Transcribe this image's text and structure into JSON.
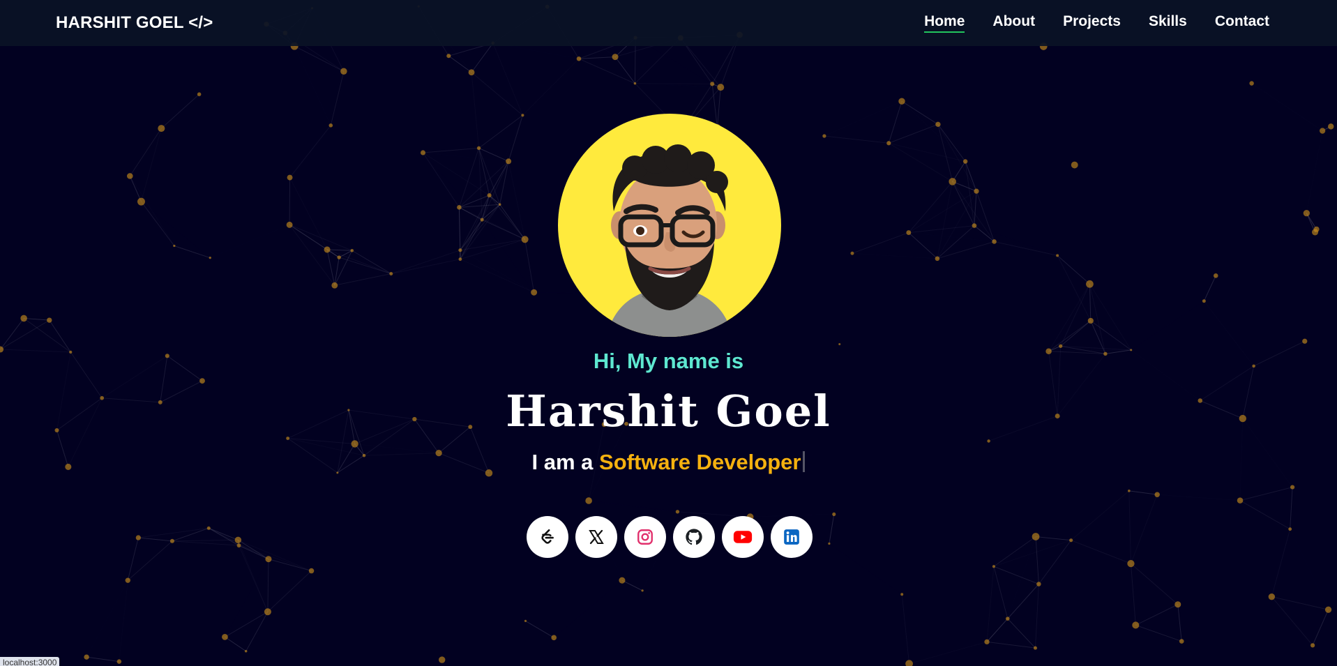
{
  "navbar": {
    "logo": "HARSHIT GOEL </>",
    "links": [
      {
        "label": "Home",
        "active": true
      },
      {
        "label": "About",
        "active": false
      },
      {
        "label": "Projects",
        "active": false
      },
      {
        "label": "Skills",
        "active": false
      },
      {
        "label": "Contact",
        "active": false
      }
    ]
  },
  "hero": {
    "greeting": "Hi, My name is",
    "name": "Harshit Goel",
    "role_prefix": "I am a",
    "role_highlight": "Software Developer"
  },
  "socials": [
    {
      "icon": "leetcode-icon"
    },
    {
      "icon": "x-icon"
    },
    {
      "icon": "instagram-icon"
    },
    {
      "icon": "github-icon"
    },
    {
      "icon": "youtube-icon"
    },
    {
      "icon": "linkedin-icon"
    }
  ],
  "status_bar": {
    "url": "localhost:3000"
  },
  "colors": {
    "background": "#020121",
    "accent_teal": "#5ee8d0",
    "accent_gold": "#f5b10f",
    "nav_underline": "#22c55e",
    "avatar_bg": "#ffea3d",
    "particle": "#c58a1c"
  }
}
